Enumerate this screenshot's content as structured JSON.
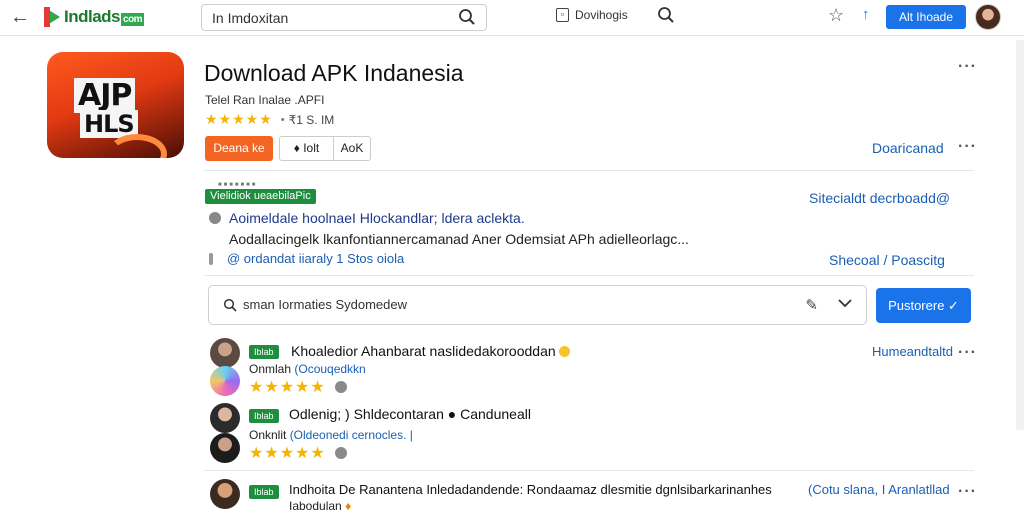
{
  "topbar": {
    "logo_text": "Indlads",
    "logo_tld": "com",
    "search_value": "In  Imdoxitan",
    "doc_label": "Dovihogis",
    "action_button": "Alt Ihoade"
  },
  "app": {
    "icon_text_top": "AJP",
    "icon_text_bottom": "HLS",
    "title": "Download APK Indanesia",
    "subtitle": "Telel Ran  Inalae .APFI",
    "stars": "★★★★★",
    "rating_extra": "₹1 S. IM",
    "primary_button": "Deana ke",
    "secondary_button_a": "♦ Iolt",
    "secondary_button_b": "AoK",
    "download_link": "Doaricanad"
  },
  "info": {
    "tiny_label": "■■■■■■■",
    "tag": "Vielidiok ueaebilaPic",
    "line1": "Aoimeldale hoolnaeI  Hlockandlar;  ldera aclekta.",
    "line2": "Aodallacingelk  lkanfontiannercamanad Aner Odemsiat APh adielleorlagc...",
    "line3": "@  ordandat iiaraly 1  Stos oiola",
    "right_link1": "Sitecialdt  decrboadd@",
    "right_link2": "Shecoal / Poascitg"
  },
  "comment": {
    "placeholder": "sman  Iormaties  Sydomedew",
    "post_button": "Pustorere ✓"
  },
  "reviews": [
    {
      "tag": "Iblab",
      "name": "Khoaledior Ahanbarat naslidedakorooddan",
      "sub_plain": "Onmlah ",
      "sub_link": "(Ocouqedkkn",
      "stars": "★★★★★",
      "right_link": "Humeandtaltd"
    },
    {
      "tag": "Iblab",
      "name": "Odlenig; ) Shldecontaran ●   Canduneall",
      "sub_plain": "Onknlit ",
      "sub_link": "(Oldeonedi cernocles. |",
      "stars": "★★★★★",
      "right_link": ""
    },
    {
      "tag": "Iblab",
      "name": "Indhoita De Ranantena Inledadandende:  Rondaamaz dlesmitie dgnlsibarkarinanhes",
      "sub_plain": "Iabodulan ",
      "sub_link": "",
      "stars": "",
      "right_link": "(Cotu slana,  I  Aranlatllad"
    }
  ],
  "icons": [
    "back-arrow-icon",
    "search-icon",
    "document-icon",
    "star-icon",
    "upload-icon",
    "more-icon",
    "info-icon",
    "pencil-icon",
    "chevron-down-icon",
    "chat-icon"
  ],
  "colors": {
    "accent": "#1a73e8",
    "orange": "#f26522",
    "green": "#1e8e3e",
    "star": "#f4b400",
    "link": "#1a5fb4"
  }
}
